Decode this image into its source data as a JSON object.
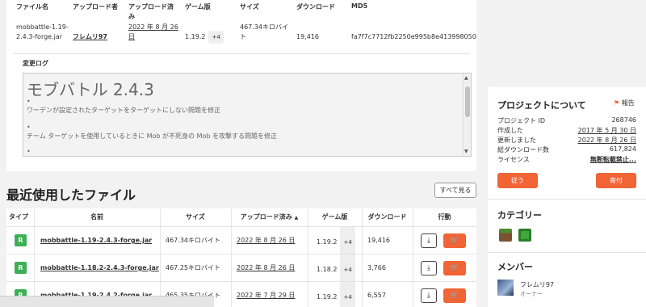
{
  "file_info": {
    "headers": {
      "filename": "ファイル名",
      "uploader": "アップロード者",
      "uploaded": "アップロード済",
      "uploaded_line2": "み",
      "game_version": "ゲーム版",
      "size": "サイズ",
      "downloads": "ダウンロード",
      "md5": "MD5"
    },
    "filename_line1": "mobbattle-1.19-",
    "filename_line2": "2.4.3-forge.jar",
    "uploader": "フレムリ97",
    "uploaded_line1": "2022 年 8 月 26",
    "uploaded_line2": "日",
    "game_version": "1.19.2",
    "game_version_more": "+4",
    "size_line1": "467.34キロバイ",
    "size_line2": "ト",
    "downloads": "19,416",
    "md5": "fa7f7c7712fb2250e995b8e413998050"
  },
  "changelog": {
    "label": "変更ログ",
    "title": "モブバトル 2.4.3",
    "lines": [
      "•",
      "ワーデンが設定されたターゲットをターゲットにしない問題を修正",
      "•",
      "チーム ターゲットを使用しているときに Mob が不死身の Mob を攻撃する問題を修正",
      "•"
    ]
  },
  "recent": {
    "title": "最近使用したファイル",
    "view_all": "すべて見る",
    "columns": {
      "type": "タイプ",
      "name": "名前",
      "size": "サイズ",
      "uploaded": "アップロード済み",
      "game_version": "ゲーム版",
      "downloads": "ダウンロード",
      "actions": "行動"
    },
    "rows": [
      {
        "type": "R",
        "name": "mobbattle-1.19-2.4.3-forge.jar",
        "size": "467.34キロバイト",
        "uploaded": "2022 年 8 月 26 日",
        "game_version": "1.19.2",
        "more": "+4",
        "downloads": "19,416"
      },
      {
        "type": "R",
        "name": "mobbattle-1.18.2-2.4.3-forge.jar",
        "size": "467.25キロバイト",
        "uploaded": "2022 年 8 月 26 日",
        "game_version": "1.18.2",
        "more": "+4",
        "downloads": "3,766"
      },
      {
        "type": "R",
        "name": "mobbattle-1.19-2.4.2-forge.jar",
        "size": "465.35キロバイト",
        "uploaded": "2022 年 7 月 29 日",
        "game_version": "1.19.2",
        "more": "+4",
        "downloads": "6,557"
      }
    ]
  },
  "about": {
    "title": "プロジェクトについて",
    "report": "報告",
    "rows": [
      {
        "key": "プロジェクト ID",
        "value": "268746"
      },
      {
        "key": "作成した",
        "value": "2017 年 5 月 30 日"
      },
      {
        "key": "更新しました",
        "value": "2022 年 8 月 26 日"
      },
      {
        "key": "総ダウンロード数",
        "value": "617,824"
      },
      {
        "key": "ライセンス",
        "value": "無断転載禁止..."
      }
    ],
    "follow": "従う",
    "donate": "寄付"
  },
  "categories": {
    "title": "カテゴリー"
  },
  "members": {
    "title": "メンバー",
    "name": "フレムリ97",
    "role": "オーナー"
  },
  "colors": {
    "accent": "#f16436",
    "badge": "#3cb054"
  }
}
